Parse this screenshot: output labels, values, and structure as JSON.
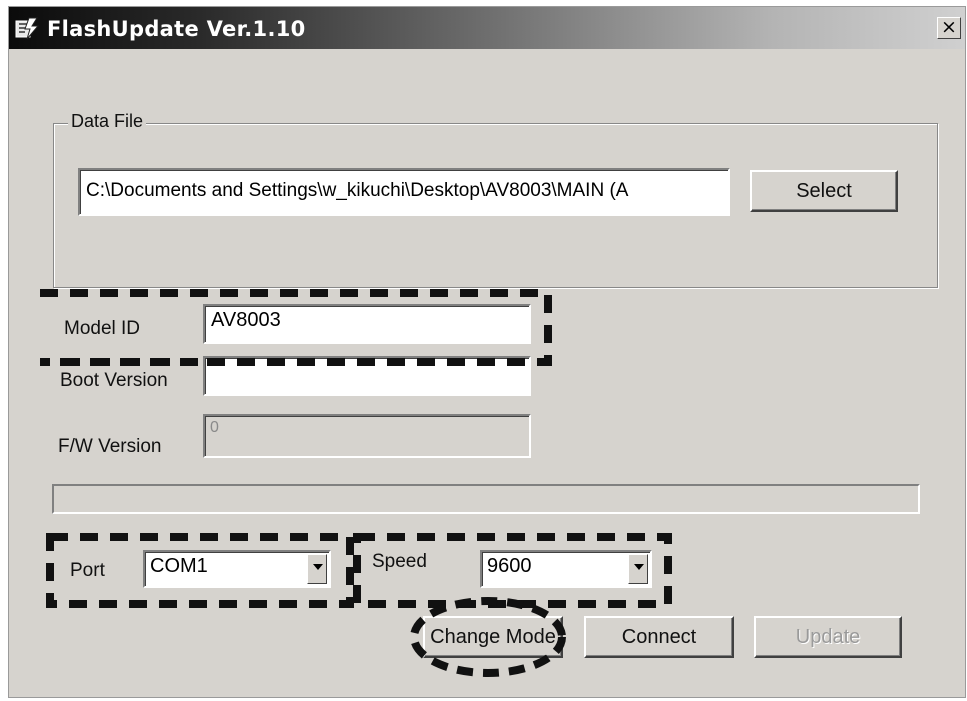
{
  "window": {
    "title": "FlashUpdate Ver.1.10",
    "close_label": "×",
    "icon": "flash-app-icon"
  },
  "data_file": {
    "group_label": "Data File",
    "path_value": "C:\\Documents and Settings\\w_kikuchi\\Desktop\\AV8003\\MAIN (A",
    "select_label": "Select"
  },
  "model_id": {
    "label": "Model ID",
    "value": "AV8003"
  },
  "boot_version": {
    "label": "Boot Version",
    "value": ""
  },
  "fw_version": {
    "label": "F/W Version",
    "value": "0"
  },
  "progress": {
    "fraction": 0
  },
  "port": {
    "label": "Port",
    "value": "COM1"
  },
  "speed": {
    "label": "Speed",
    "value": "9600"
  },
  "buttons": {
    "change_mode": "Change Mode",
    "connect": "Connect",
    "update": "Update"
  },
  "colors": {
    "window_bg": "#d6d3ce",
    "highlight_dash": "#111111"
  }
}
